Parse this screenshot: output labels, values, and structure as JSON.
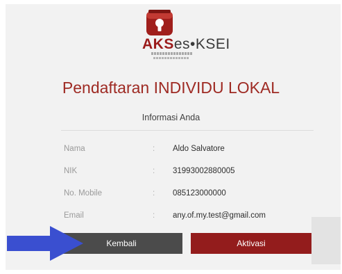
{
  "logo": {
    "brand_part1": "AKS",
    "brand_part2": "es",
    "brand_dot": "•",
    "brand_part3": "KSEI",
    "icon": "lock-icon"
  },
  "page": {
    "title": "Pendaftaran INDIVIDU LOKAL",
    "section_title": "Informasi Anda"
  },
  "fields": [
    {
      "label": "Nama",
      "separator": ":",
      "value": "Aldo Salvatore"
    },
    {
      "label": "NIK",
      "separator": ":",
      "value": "31993002880005"
    },
    {
      "label": "No. Mobile",
      "separator": ":",
      "value": "085123000000"
    },
    {
      "label": "Email",
      "separator": ":",
      "value": "any.of.my.test@gmail.com"
    }
  ],
  "buttons": {
    "back_label": "Kembali",
    "activate_label": "Aktivasi"
  },
  "overlay": {
    "pointer": "arrow-right-icon",
    "pointer_color": "#3a4fd0"
  },
  "colors": {
    "brand_red": "#9e2a23",
    "button_red": "#931c1c",
    "button_dark": "#4b4b4b"
  }
}
